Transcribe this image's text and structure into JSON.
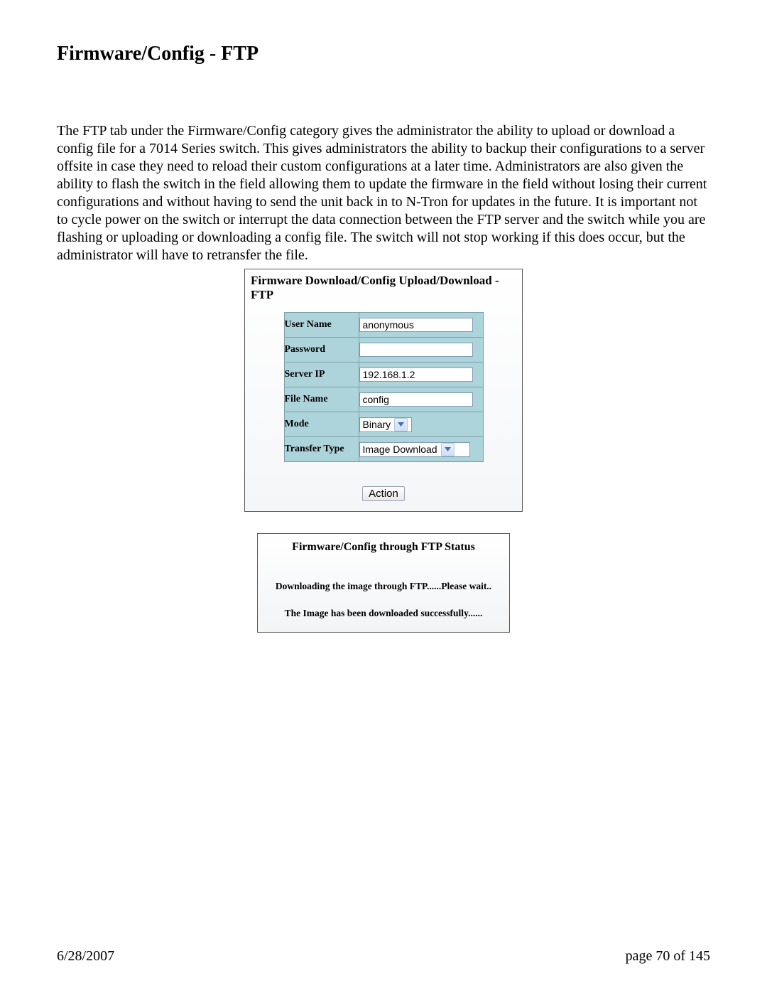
{
  "title": "Firmware/Config - FTP",
  "paragraph": "The FTP tab under the Firmware/Config category gives the administrator the ability to upload or download a config file for a 7014 Series switch.  This gives administrators the ability to backup their configurations to a server offsite in case they need to reload their custom configurations at a later time.  Administrators are also given the ability to flash the switch in the field allowing them to update the firmware in the field without losing their current configurations and without having to send the unit back in to N-Tron for updates in the future.  It is important not to cycle power on the switch or interrupt the data connection between the FTP server and the switch while you are flashing or uploading or downloading a config file.  The switch will not stop working if this does occur, but the administrator will have to retransfer the file.",
  "form": {
    "title": "Firmware Download/Config Upload/Download - FTP",
    "labels": {
      "username": "User Name",
      "password": "Password",
      "serverip": "Server IP",
      "filename": "File Name",
      "mode": "Mode",
      "transfer": "Transfer Type"
    },
    "values": {
      "username": "anonymous",
      "password": "",
      "serverip": "192.168.1.2",
      "filename": "config",
      "mode": "Binary",
      "transfer": "Image Download"
    },
    "action_label": "Action"
  },
  "status": {
    "title": "Firmware/Config through FTP Status",
    "line1": "Downloading the image through FTP......Please wait..",
    "line2": "The Image has been downloaded successfully......"
  },
  "footer": {
    "date": "6/28/2007",
    "page": "page 70 of 145"
  }
}
